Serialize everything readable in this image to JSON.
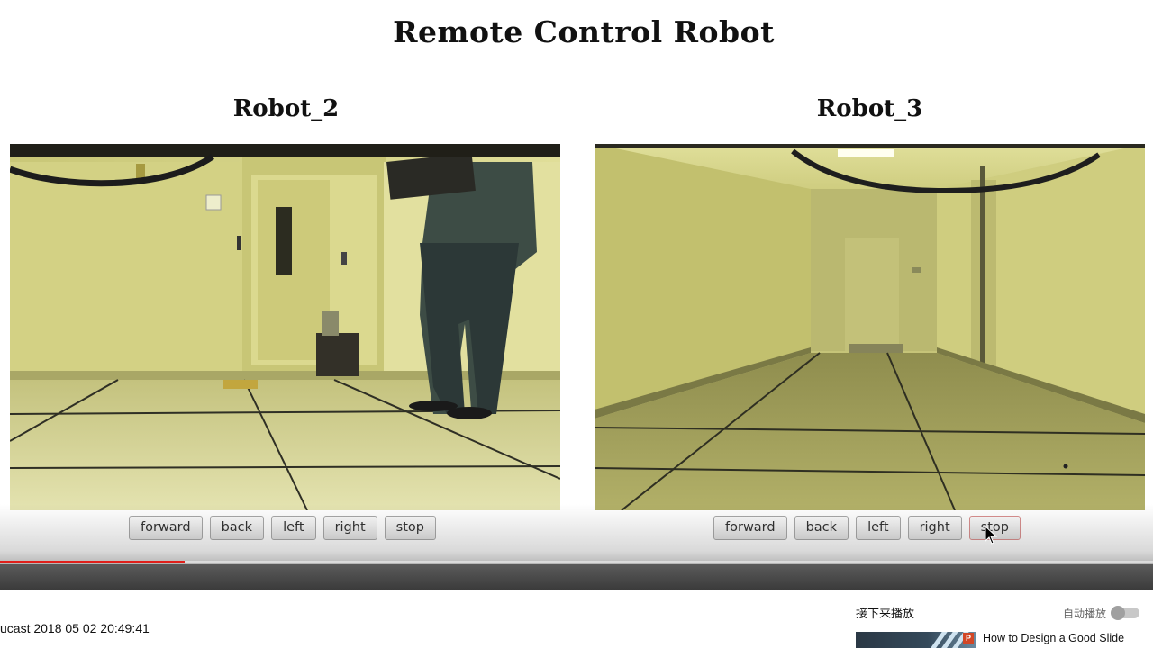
{
  "page": {
    "title": "Remote Control Robot"
  },
  "robots": [
    {
      "name": "Robot_2",
      "buttons": [
        "forward",
        "back",
        "left",
        "right",
        "stop"
      ]
    },
    {
      "name": "Robot_3",
      "buttons": [
        "forward",
        "back",
        "left",
        "right",
        "stop"
      ]
    }
  ],
  "player": {
    "progress_fraction": 0.16,
    "progress_color": "#e0201b",
    "video_title": "ucast 2018 05 02 20:49:41",
    "up_next_label": "接下来播放",
    "autoplay_label": "自动播放",
    "autoplay_on": false,
    "recommended_title": "How to Design a Good Slide"
  }
}
